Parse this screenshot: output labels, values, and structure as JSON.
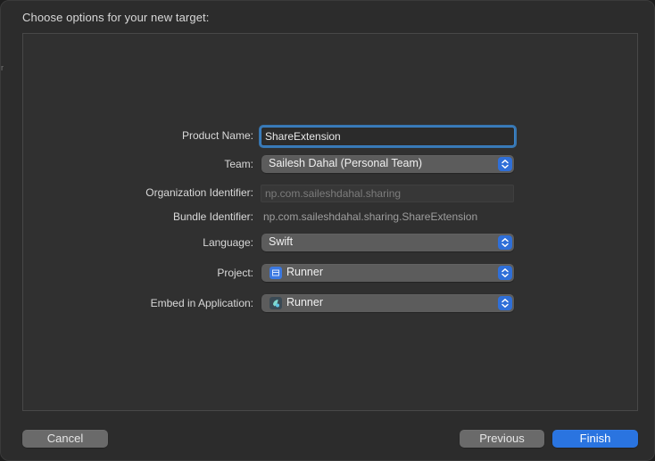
{
  "sheet": {
    "title": "Choose options for your new target:"
  },
  "form": {
    "product_name": {
      "label": "Product Name:",
      "value": "ShareExtension"
    },
    "team": {
      "label": "Team:",
      "value": "Sailesh Dahal (Personal Team)"
    },
    "organization_identifier": {
      "label": "Organization Identifier:",
      "placeholder": "np.com.saileshdahal.sharing"
    },
    "bundle_identifier": {
      "label": "Bundle Identifier:",
      "value": "np.com.saileshdahal.sharing.ShareExtension"
    },
    "language": {
      "label": "Language:",
      "value": "Swift"
    },
    "project": {
      "label": "Project:",
      "value": "Runner",
      "icon": "xcode-project-icon"
    },
    "embed_in_application": {
      "label": "Embed in Application:",
      "value": "Runner",
      "icon": "flutter-app-icon"
    }
  },
  "buttons": {
    "cancel": "Cancel",
    "previous": "Previous",
    "finish": "Finish"
  },
  "colors": {
    "accent": "#2a74e0",
    "focus_ring": "#3882c8",
    "background": "#2c2c2c"
  }
}
